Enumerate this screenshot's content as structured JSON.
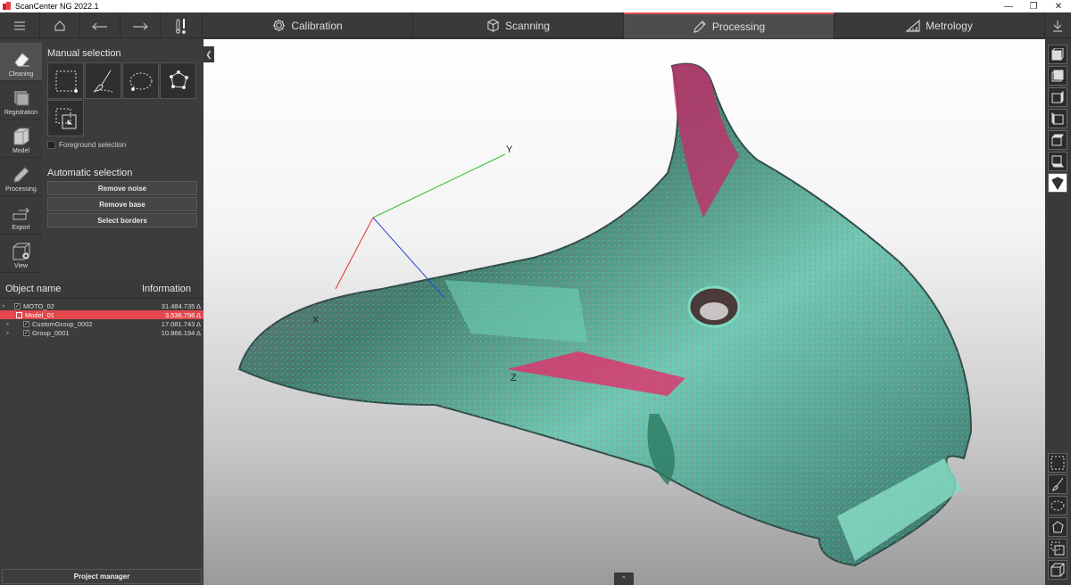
{
  "window": {
    "title": "ScanCenter NG 2022.1",
    "controls": [
      "—",
      "❐",
      "✕"
    ]
  },
  "tabs": [
    {
      "label": "Calibration",
      "icon": "gear-icon"
    },
    {
      "label": "Scanning",
      "icon": "cube-icon"
    },
    {
      "label": "Processing",
      "icon": "pencil-icon"
    },
    {
      "label": "Metrology",
      "icon": "ruler-icon"
    }
  ],
  "tools": [
    {
      "label": "Cleaning"
    },
    {
      "label": "Registration"
    },
    {
      "label": "Model"
    },
    {
      "label": "Processing"
    },
    {
      "label": "Export"
    },
    {
      "label": "View"
    }
  ],
  "panel": {
    "manual_title": "Manual selection",
    "foreground_label": "Foreground selection",
    "auto_title": "Automatic selection",
    "buttons": [
      "Remove noise",
      "Remove base",
      "Select borders"
    ]
  },
  "objects": {
    "header_name": "Object name",
    "header_info": "Information",
    "rows": [
      {
        "name": "MOTO_02",
        "value": "31.484.735 Δ"
      },
      {
        "name": "Model_01",
        "value": "3.536.798 Δ"
      },
      {
        "name": "CustomGroup_0002",
        "value": "17.081.743 Δ"
      },
      {
        "name": "Group_0001",
        "value": "10.866.194 Δ"
      }
    ]
  },
  "project_manager": "Project manager",
  "axes": {
    "x": "X",
    "y": "Y",
    "z": "Z"
  },
  "colors": {
    "active_tab": "#e05050",
    "selection": "#e2484c",
    "x_axis": "#e03030",
    "y_axis": "#30c030",
    "z_axis": "#3040e0"
  }
}
